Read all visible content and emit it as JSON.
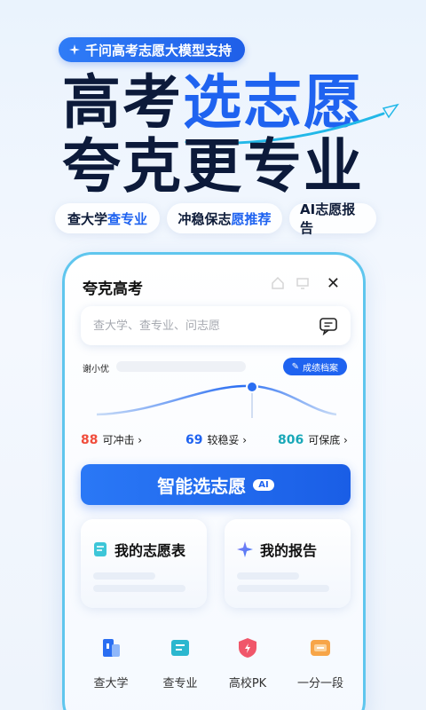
{
  "banner": {
    "pill_text": "千问高考志愿大模型支持",
    "headline_part1": "高考",
    "headline_part2": "选志愿",
    "headline_line2": "夸克更专业"
  },
  "chips": [
    {
      "text_a": "查大学",
      "text_b": "查专业"
    },
    {
      "text_a": "冲稳保志",
      "text_b": "愿推荐"
    },
    {
      "text_a": "AI志愿报告",
      "text_b": ""
    }
  ],
  "app": {
    "title": "夸克高考",
    "search_placeholder": "查大学、查专业、问志愿",
    "user_name": "谢小优",
    "profile_button": "成绩档案",
    "stats": [
      {
        "num": "88",
        "label": "可冲击 ›"
      },
      {
        "num": "69",
        "label": "较稳妥 ›"
      },
      {
        "num": "806",
        "label": "可保底 ›"
      }
    ],
    "smart_button": "智能选志愿",
    "ai_badge": "AI",
    "cards": [
      {
        "title": "我的志愿表"
      },
      {
        "title": "我的报告"
      }
    ],
    "nav": [
      {
        "label": "查大学"
      },
      {
        "label": "查专业"
      },
      {
        "label": "高校PK"
      },
      {
        "label": "一分一段"
      }
    ]
  },
  "colors": {
    "brand_blue": "#1f63f0",
    "red": "#f04d3c",
    "teal": "#19a8b8",
    "phone_border": "#5fc6ee"
  }
}
